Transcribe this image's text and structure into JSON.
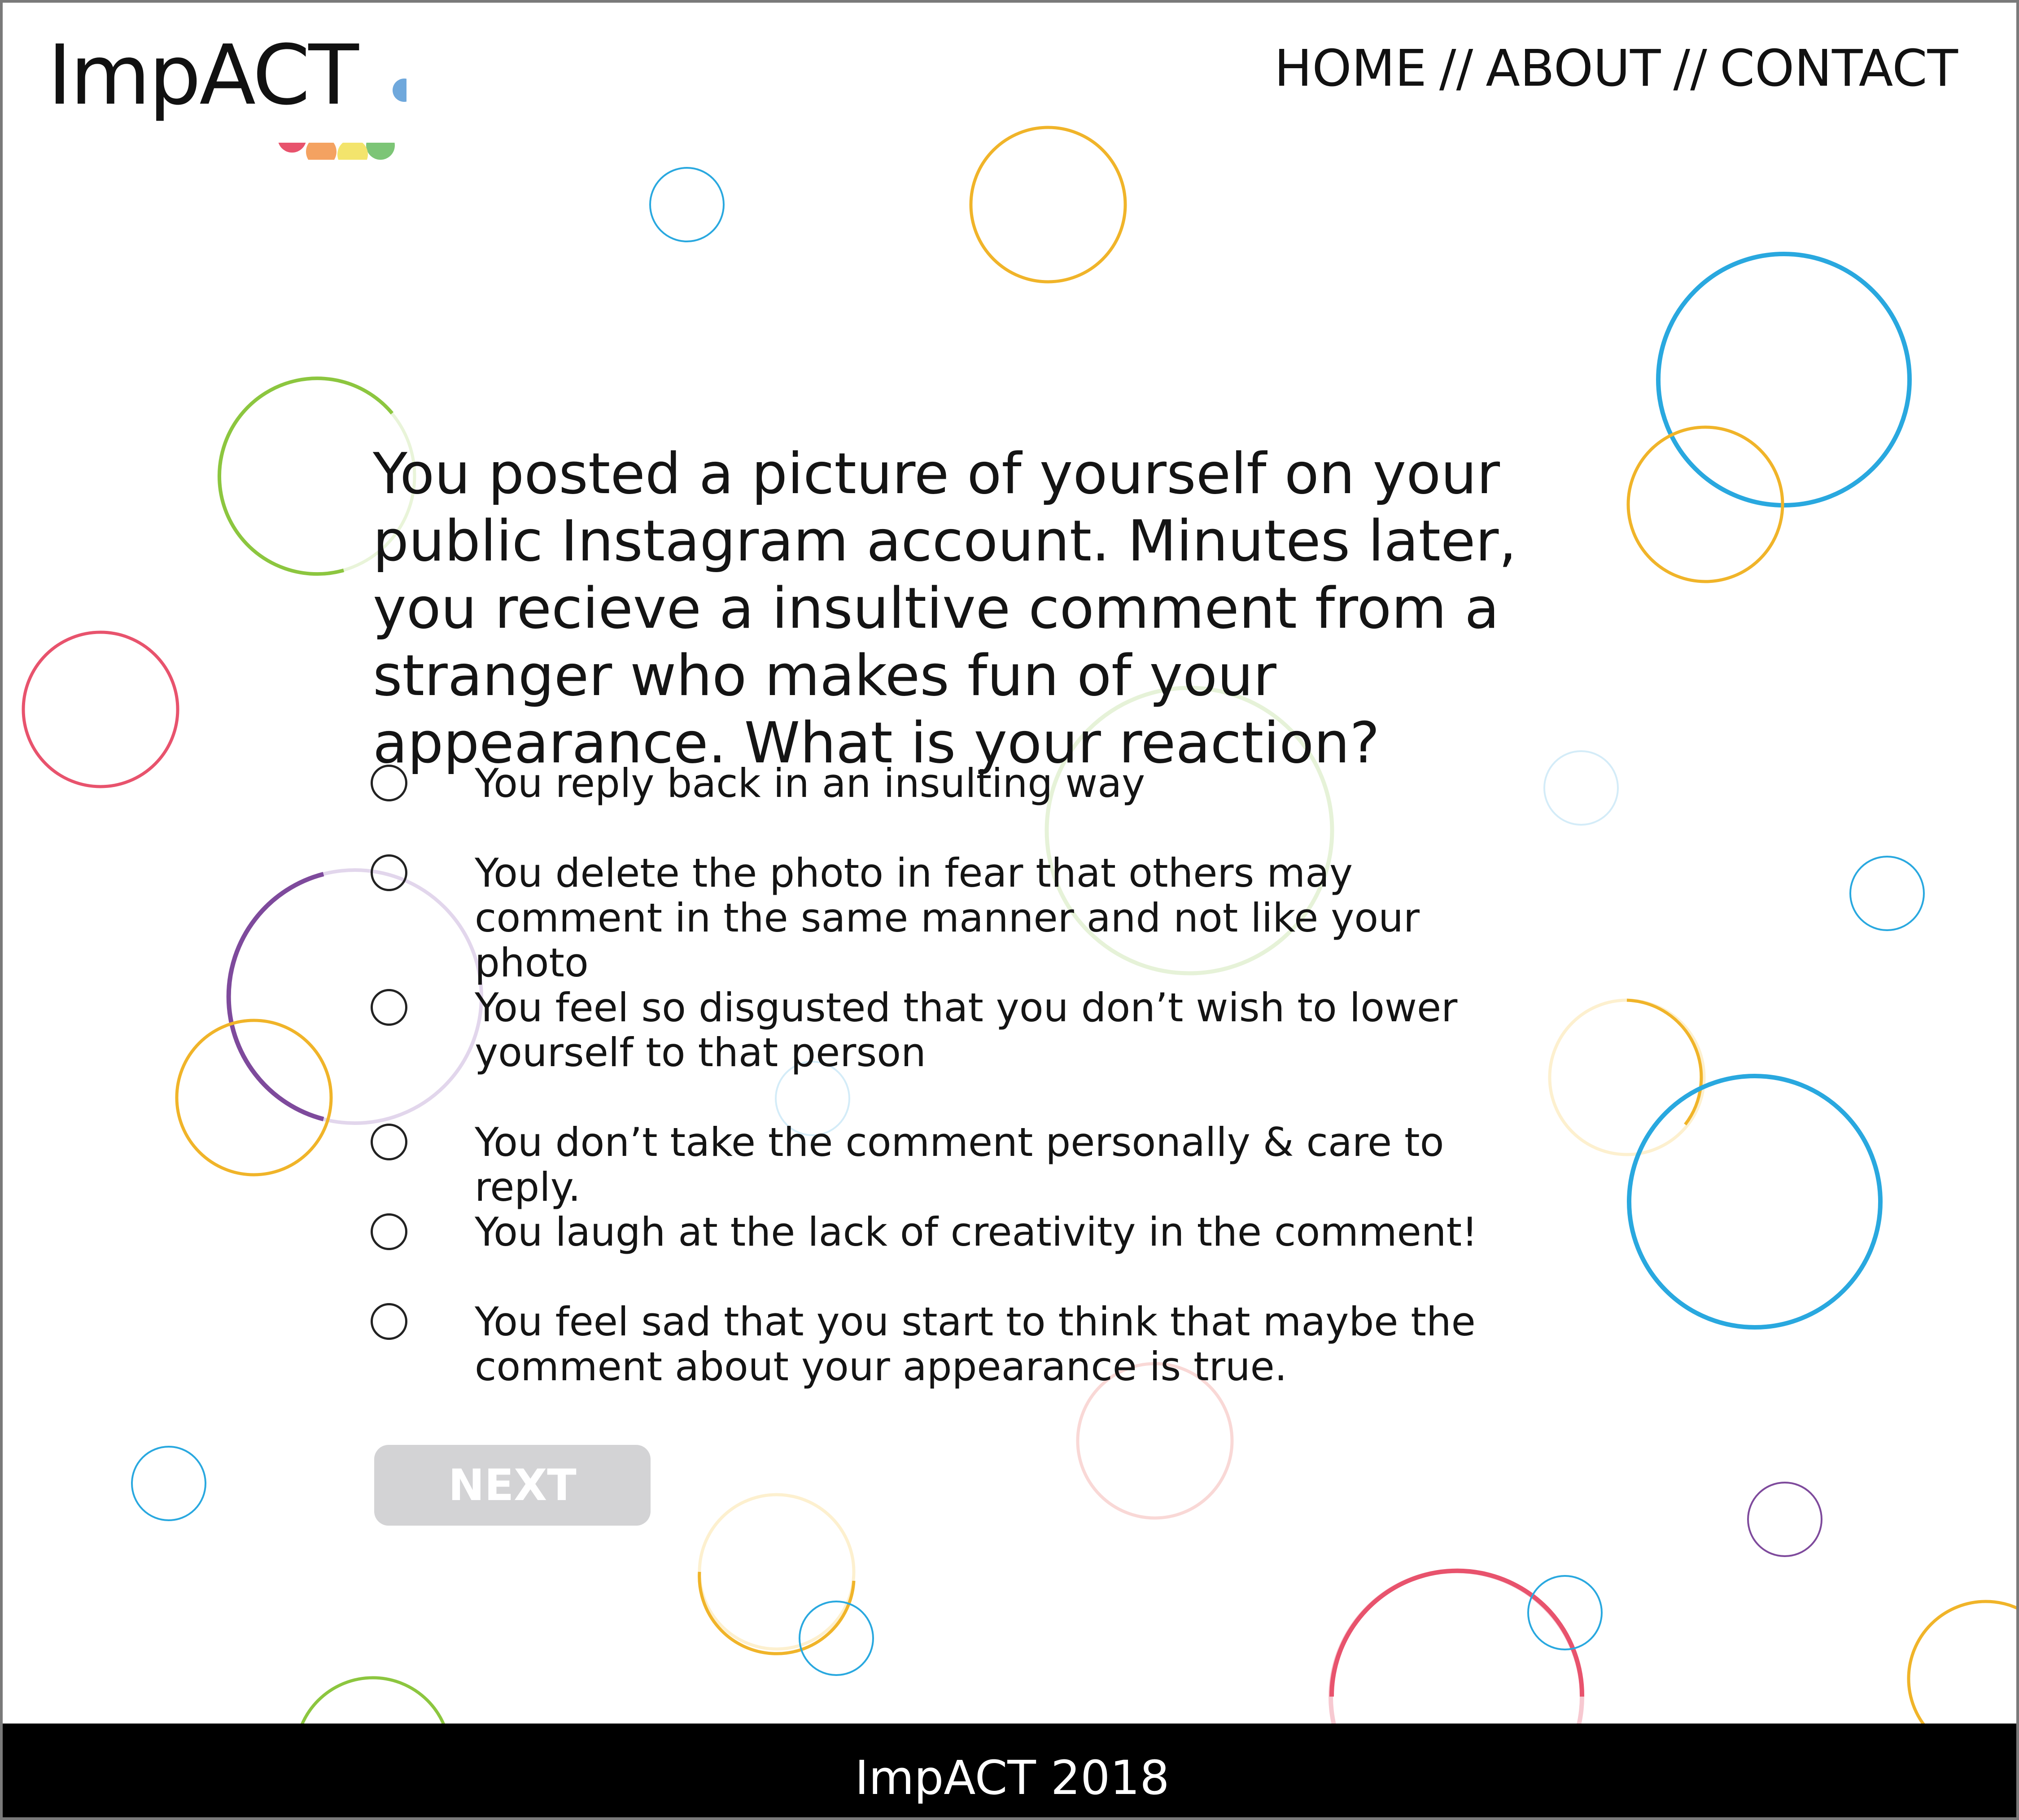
{
  "brand": {
    "logo_text": "ImpACT"
  },
  "nav": {
    "home": "HOME",
    "about": "ABOUT",
    "contact": "CONTACT",
    "separator": "//"
  },
  "question": {
    "text": "You posted a picture of yourself on your public Instagram account. Minutes later, you recieve a insultive comment from a stranger who makes fun of your appearance. What is your reaction?"
  },
  "options": [
    {
      "label": "You reply back in an insulting way",
      "selected": false
    },
    {
      "label": "You delete the photo in fear that others may comment in the same manner and not like your photo",
      "selected": false
    },
    {
      "label": "You feel so disgusted that you don’t wish to lower yourself to that person",
      "selected": false
    },
    {
      "label": "You don’t take the comment personally & care to reply.",
      "selected": false
    },
    {
      "label": "You laugh at the lack of creativity in the comment!",
      "selected": false
    },
    {
      "label": "You feel sad that you start to think that maybe the comment about your appearance is true.",
      "selected": false
    }
  ],
  "next_button": {
    "label": "NEXT",
    "disabled": true
  },
  "footer": {
    "text": "ImpACT 2018"
  },
  "colors": {
    "blue": "#29a8df",
    "yellow": "#f0b429",
    "green": "#8cc63f",
    "red": "#e8536d",
    "purple": "#7e4a9c",
    "button_disabled": "#d3d3d5"
  }
}
